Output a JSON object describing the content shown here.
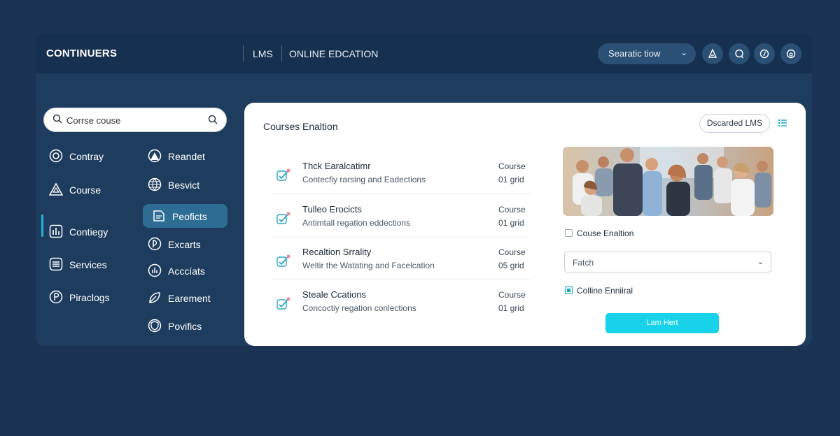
{
  "header": {
    "brand": "CONTINUERS",
    "nav": [
      "LMS",
      "ONLINE EDCATION"
    ],
    "selector_label": "Searatic tiow",
    "icons": [
      "user-icon",
      "chat-icon",
      "compass-icon",
      "info-icon"
    ]
  },
  "search": {
    "value": "Corrse couse"
  },
  "sidebar": {
    "left": [
      {
        "label": "Contray",
        "icon": "badge-icon"
      },
      {
        "label": "Course",
        "icon": "warning-icon"
      },
      {
        "label": "Contiegy",
        "icon": "chart-icon"
      },
      {
        "label": "Services",
        "icon": "list-icon"
      },
      {
        "label": "Piraclogs",
        "icon": "tag-icon"
      }
    ],
    "right": [
      {
        "label": "Reandet",
        "icon": "person-icon"
      },
      {
        "label": "Besvict",
        "icon": "globe-icon"
      },
      {
        "label": "Peoficts",
        "icon": "document-icon"
      },
      {
        "label": "Excarts",
        "icon": "clock-icon"
      },
      {
        "label": "Acccíats",
        "icon": "chart-icon"
      },
      {
        "label": "Earement",
        "icon": "leaf-icon"
      },
      {
        "label": "Povifics",
        "icon": "shield-icon"
      }
    ],
    "active_left": "Contiegy",
    "active_right": "Peoficts"
  },
  "card": {
    "title": "Courses Enaltion",
    "badge_label": "Dscarded LMS",
    "rows": [
      {
        "title": "Thck Earalcatimr",
        "subtitle": "Contecfiy rarsing and Eadections",
        "meta1": "Course",
        "meta2": "01 grid"
      },
      {
        "title": "Tulleo Erocicts",
        "subtitle": "Antimtall regation eddections",
        "meta1": "Course",
        "meta2": "01 grid"
      },
      {
        "title": "Recaltion Srrality",
        "subtitle": "Weltir the Watating and Facelcation",
        "meta1": "Course",
        "meta2": "05 grid"
      },
      {
        "title": "Steale Ccations",
        "subtitle": "Concoctiy regation conlections",
        "meta1": "Course",
        "meta2": "01 grid"
      }
    ],
    "checkbox1_label": "Couse Enaltion",
    "select_value": "Fatch",
    "checkbox2_label": "Colline Enniiral",
    "cta_label": "Lam Hert"
  },
  "colors": {
    "background": "#1a3352",
    "accent": "#17d2e8",
    "active": "#2d6c93"
  }
}
